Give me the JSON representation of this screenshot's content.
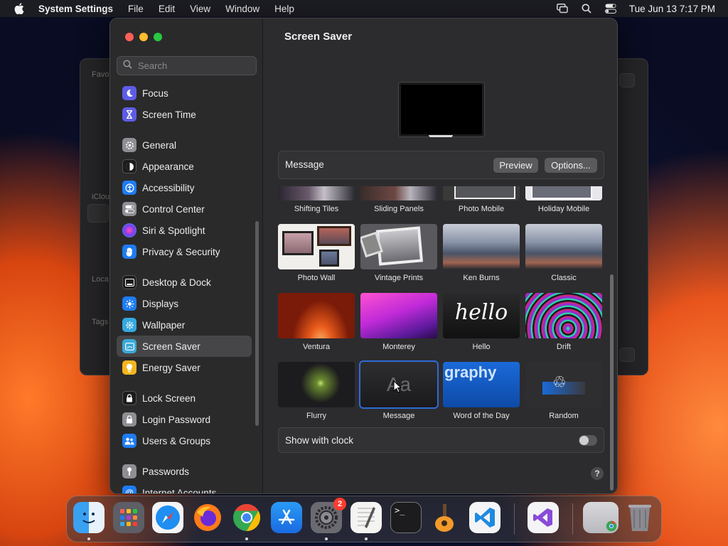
{
  "menubar": {
    "app_name": "System Settings",
    "menus": [
      "File",
      "Edit",
      "View",
      "Window",
      "Help"
    ],
    "datetime": "Tue Jun 13  7:17 PM"
  },
  "background_window": {
    "labels": [
      "Favo",
      "iClou",
      "Loca",
      "Tags"
    ]
  },
  "sidebar": {
    "search_placeholder": "Search",
    "items": [
      {
        "label": "Focus",
        "icon": "moon-icon",
        "color": "#5e5ce6"
      },
      {
        "label": "Screen Time",
        "icon": "hourglass-icon",
        "color": "#5e5ce6"
      },
      {
        "label": "General",
        "icon": "gear-icon",
        "color": "#8e8e93"
      },
      {
        "label": "Appearance",
        "icon": "appearance-icon",
        "color": "#1c1c1e"
      },
      {
        "label": "Accessibility",
        "icon": "accessibility-icon",
        "color": "#1e7cf2"
      },
      {
        "label": "Control Center",
        "icon": "control-center-icon",
        "color": "#8e8e93"
      },
      {
        "label": "Siri & Spotlight",
        "icon": "siri-icon",
        "color": "#b040d0"
      },
      {
        "label": "Privacy & Security",
        "icon": "hand-icon",
        "color": "#1e7cf2"
      },
      {
        "label": "Desktop & Dock",
        "icon": "dock-icon",
        "color": "#1c1c1e"
      },
      {
        "label": "Displays",
        "icon": "sun-icon",
        "color": "#1e7cf2"
      },
      {
        "label": "Wallpaper",
        "icon": "wallpaper-icon",
        "color": "#35a8e0"
      },
      {
        "label": "Screen Saver",
        "icon": "screen-saver-icon",
        "color": "#3aa8d8"
      },
      {
        "label": "Energy Saver",
        "icon": "bulb-icon",
        "color": "#f2b51e"
      },
      {
        "label": "Lock Screen",
        "icon": "lock-icon",
        "color": "#1c1c1e"
      },
      {
        "label": "Login Password",
        "icon": "password-icon",
        "color": "#8e8e93"
      },
      {
        "label": "Users & Groups",
        "icon": "users-icon",
        "color": "#1e7cf2"
      },
      {
        "label": "Passwords",
        "icon": "key-icon",
        "color": "#8e8e93"
      },
      {
        "label": "Internet Accounts",
        "icon": "at-icon",
        "color": "#1e7cf2"
      }
    ],
    "active": "Screen Saver"
  },
  "content": {
    "title": "Screen Saver",
    "selected_saver": "Message",
    "preview_button": "Preview",
    "options_button": "Options...",
    "savers": [
      {
        "label": "Shifting Tiles"
      },
      {
        "label": "Sliding Panels"
      },
      {
        "label": "Photo Mobile"
      },
      {
        "label": "Holiday Mobile"
      },
      {
        "label": "Photo Wall"
      },
      {
        "label": "Vintage Prints"
      },
      {
        "label": "Ken Burns"
      },
      {
        "label": "Classic"
      },
      {
        "label": "Ventura"
      },
      {
        "label": "Monterey"
      },
      {
        "label": "Hello",
        "thumb_text": "hello"
      },
      {
        "label": "Drift"
      },
      {
        "label": "Flurry"
      },
      {
        "label": "Message",
        "thumb_text": "Aa",
        "selected": true
      },
      {
        "label": "Word of the Day",
        "thumb_text": "graphy"
      },
      {
        "label": "Random"
      }
    ],
    "show_with_clock_label": "Show with clock",
    "show_with_clock": false,
    "help": "?"
  },
  "dock": {
    "apps": [
      {
        "name": "Finder",
        "running": true
      },
      {
        "name": "Launchpad",
        "running": false
      },
      {
        "name": "Safari",
        "running": false
      },
      {
        "name": "Firefox",
        "running": false
      },
      {
        "name": "Chrome",
        "running": true
      },
      {
        "name": "App Store",
        "running": false
      },
      {
        "name": "System Settings",
        "running": true,
        "badge": "2"
      },
      {
        "name": "TextEdit",
        "running": true
      },
      {
        "name": "Terminal",
        "running": false
      },
      {
        "name": "GarageBand",
        "running": false
      },
      {
        "name": "Visual Studio Code",
        "running": false
      },
      {
        "name": "Visual Studio",
        "running": false
      },
      {
        "name": "Chrome Window",
        "running": false
      },
      {
        "name": "Trash",
        "running": false
      }
    ]
  }
}
